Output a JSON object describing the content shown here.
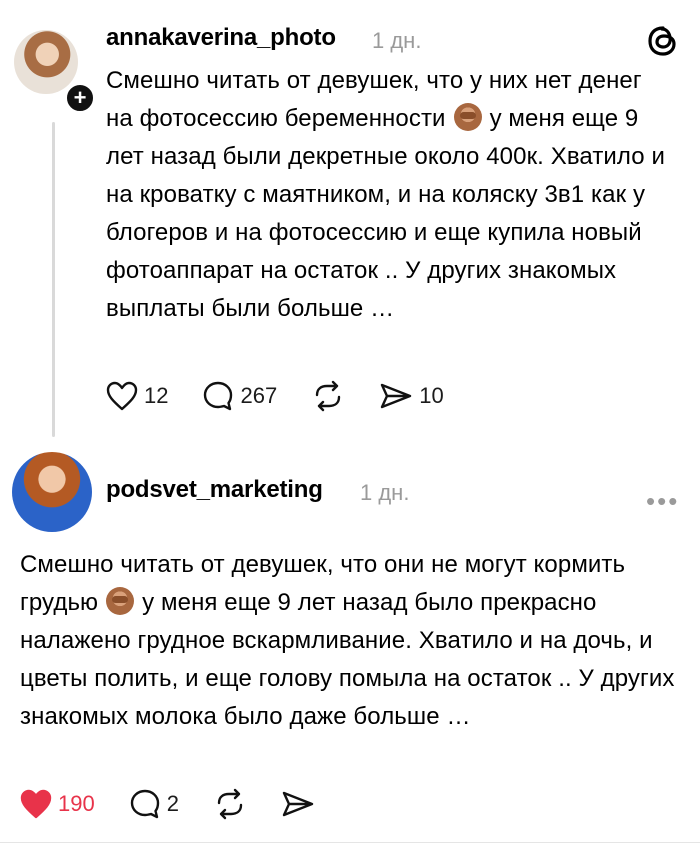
{
  "post1": {
    "username": "annakaverina_photo",
    "time": "1 дн.",
    "text_parts": [
      "Смешно читать от девушек, что у них нет денег на фотосессию беременности",
      "у меня еще 9 лет назад были декретные около 400к. Хватило и на кроватку с маятником, и на коляску 3в1 как у блогеров и на фотосессию и еще купила новый фотоаппарат на остаток .. У других знакомых выплаты были больше …"
    ],
    "likes": "12",
    "comments": "267",
    "shares": "10",
    "avatar_icon": "avatar-photo",
    "follow_icon": "plus-icon"
  },
  "post2": {
    "username": "podsvet_marketing",
    "time": "1 дн.",
    "text_parts": [
      "Смешно читать от девушек, что они не могут кормить грудью",
      "у меня еще 9 лет назад было прекрасно налажено грудное вскармливание. Хватило и на дочь, и цветы полить, и еще голову помыла на остаток .. У других знакомых молока было даже больше …"
    ],
    "likes": "190",
    "comments": "2",
    "like_color": "#e8334a"
  },
  "icons": [
    "threads-logo-icon",
    "heart-icon",
    "comment-icon",
    "repost-icon",
    "share-icon",
    "more-icon",
    "see-no-evil-monkey-icon"
  ]
}
